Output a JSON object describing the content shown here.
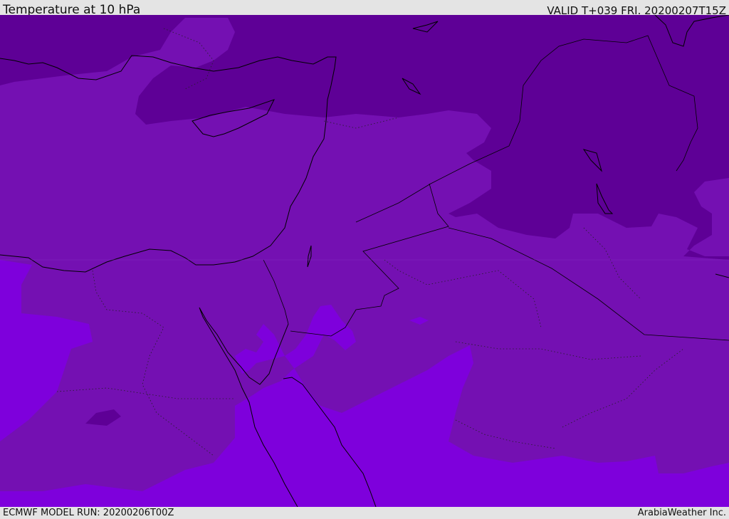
{
  "header": {
    "title": "Temperature at 10 hPa",
    "valid_time": "VALID T+039 FRI. 20200207T15Z"
  },
  "footer": {
    "model_run": "ECMWF MODEL RUN: 20200206T00Z",
    "credit": "ArabiaWeather Inc."
  },
  "map": {
    "colors": {
      "dark_band": "#5e0096",
      "mid_band": "#7410b2",
      "light_band": "#7e00dc",
      "coast": "#000000",
      "border": "#000000"
    }
  }
}
